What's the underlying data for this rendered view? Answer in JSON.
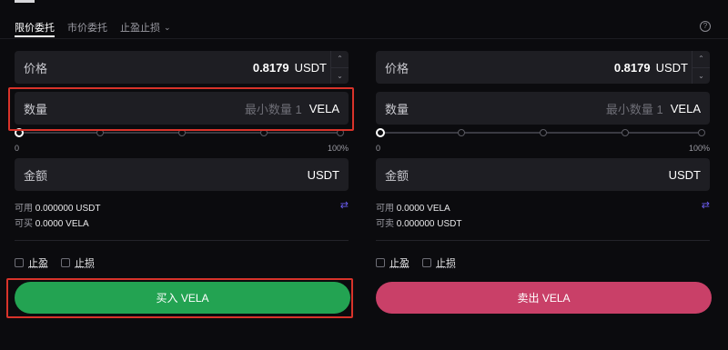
{
  "tabs": [
    {
      "label": "限价委托",
      "active": true
    },
    {
      "label": "市价委托",
      "active": false
    },
    {
      "label": "止盈止损",
      "active": false,
      "dropdown": true
    }
  ],
  "help_icon": "question-circle-icon",
  "buy": {
    "price": {
      "label": "价格",
      "value": "0.8179",
      "unit": "USDT"
    },
    "quantity": {
      "label": "数量",
      "placeholder": "最小数量 1",
      "unit": "VELA"
    },
    "slider": {
      "min_label": "0",
      "max_label": "100%",
      "value_percent": 0
    },
    "amount": {
      "label": "金额",
      "unit": "USDT"
    },
    "available": {
      "label": "可用",
      "value": "0.000000 USDT"
    },
    "can_trade": {
      "label": "可买",
      "value": "0.0000 VELA"
    },
    "take_profit": "止盈",
    "stop_loss": "止损",
    "button": "买入 VELA"
  },
  "sell": {
    "price": {
      "label": "价格",
      "value": "0.8179",
      "unit": "USDT"
    },
    "quantity": {
      "label": "数量",
      "placeholder": "最小数量 1",
      "unit": "VELA"
    },
    "slider": {
      "min_label": "0",
      "max_label": "100%",
      "value_percent": 0
    },
    "amount": {
      "label": "金额",
      "unit": "USDT"
    },
    "available": {
      "label": "可用",
      "value": "0.0000 VELA"
    },
    "can_trade": {
      "label": "可卖",
      "value": "0.000000 USDT"
    },
    "take_profit": "止盈",
    "stop_loss": "止损",
    "button": "卖出 VELA"
  },
  "colors": {
    "buy": "#23a352",
    "sell": "#c94068",
    "accent": "#6b5cf0",
    "highlight": "#d8332a"
  }
}
